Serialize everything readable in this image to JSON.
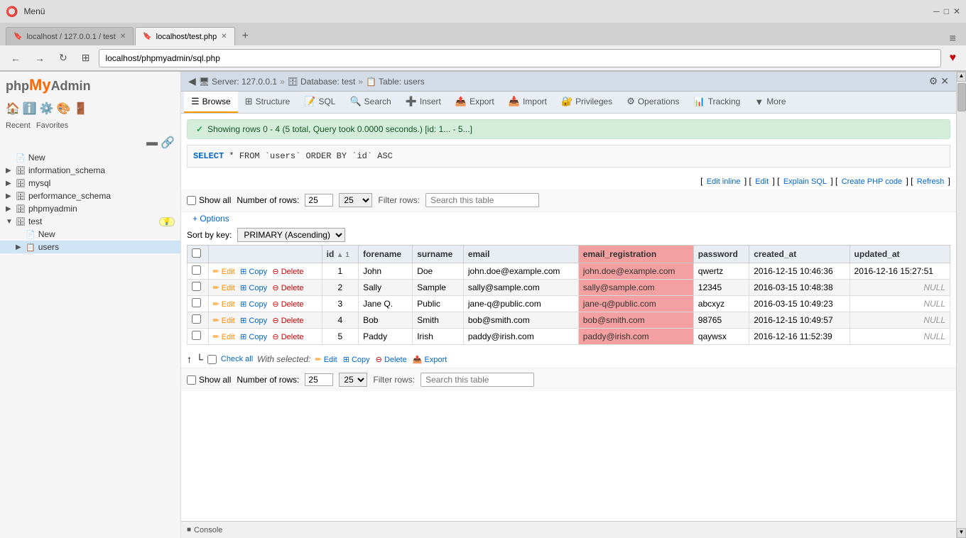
{
  "browser": {
    "title": "Menü",
    "tabs": [
      {
        "id": "tab1",
        "favicon": "🔖",
        "label": "localhost / 127.0.0.1 / test",
        "active": false,
        "closeable": true
      },
      {
        "id": "tab2",
        "favicon": "🔖",
        "label": "localhost/test.php",
        "active": true,
        "closeable": true
      }
    ],
    "new_tab_label": "+",
    "nav": {
      "back": "←",
      "forward": "→",
      "reload": "↻",
      "apps": "⊞",
      "url": "localhost/phpmyadmin/sql.php",
      "heart": "♥"
    }
  },
  "breadcrumb": {
    "parts": [
      {
        "icon": "🖥",
        "label": "Server: 127.0.0.1"
      },
      {
        "icon": "🗄",
        "label": "Database: test"
      },
      {
        "icon": "📋",
        "label": "Table: users"
      }
    ],
    "icons": [
      "⚙",
      "✕"
    ]
  },
  "toolbar": {
    "tabs": [
      {
        "icon": "☰",
        "label": "Browse",
        "active": true
      },
      {
        "icon": "📐",
        "label": "Structure",
        "active": false
      },
      {
        "icon": "📝",
        "label": "SQL",
        "active": false
      },
      {
        "icon": "🔍",
        "label": "Search",
        "active": false
      },
      {
        "icon": "➕",
        "label": "Insert",
        "active": false
      },
      {
        "icon": "📤",
        "label": "Export",
        "active": false
      },
      {
        "icon": "📥",
        "label": "Import",
        "active": false
      },
      {
        "icon": "🔐",
        "label": "Privileges",
        "active": false
      },
      {
        "icon": "⚙",
        "label": "Operations",
        "active": false
      },
      {
        "icon": "📊",
        "label": "Tracking",
        "active": false
      },
      {
        "icon": "▼",
        "label": "More",
        "active": false
      }
    ]
  },
  "alert": {
    "icon": "✓",
    "text": "Showing rows 0 - 4 (5 total, Query took 0.0000 seconds.) [id: 1... - 5...]"
  },
  "sql": {
    "text": "SELECT * FROM `users` ORDER BY `id` ASC",
    "keyword": "SELECT",
    "links": [
      {
        "label": "Edit inline"
      },
      {
        "label": "Edit"
      },
      {
        "label": "Explain SQL"
      },
      {
        "label": "Create PHP code"
      },
      {
        "label": "Refresh"
      }
    ]
  },
  "table_controls": {
    "show_all_label": "Show all",
    "num_rows_label": "Number of rows:",
    "num_rows_value": "25",
    "filter_label": "Filter rows:",
    "filter_placeholder": "Search this table"
  },
  "sort_controls": {
    "label": "Sort by key:",
    "value": "PRIMARY (Ascending)"
  },
  "options_label": "+ Options",
  "columns": [
    {
      "name": "",
      "type": "checkbox"
    },
    {
      "name": "",
      "type": "actions"
    },
    {
      "name": "id",
      "sort": "▲ 1"
    },
    {
      "name": "forename"
    },
    {
      "name": "surname"
    },
    {
      "name": "email"
    },
    {
      "name": "email_registration",
      "highlighted": true
    },
    {
      "name": "password"
    },
    {
      "name": "created_at"
    },
    {
      "name": "updated_at"
    }
  ],
  "rows": [
    {
      "id": "1",
      "forename": "John",
      "surname": "Doe",
      "email": "john.doe@example.com",
      "email_registration": "john.doe@example.com",
      "password": "qwertz",
      "created_at": "2016-12-15 10:46:36",
      "updated_at": "2016-12-16 15:27:51"
    },
    {
      "id": "2",
      "forename": "Sally",
      "surname": "Sample",
      "email": "sally@sample.com",
      "email_registration": "sally@sample.com",
      "password": "12345",
      "created_at": "2016-03-15 10:48:38",
      "updated_at": "NULL"
    },
    {
      "id": "3",
      "forename": "Jane Q.",
      "surname": "Public",
      "email": "jane-q@public.com",
      "email_registration": "jane-q@public.com",
      "password": "abcxyz",
      "created_at": "2016-03-15 10:49:23",
      "updated_at": "NULL"
    },
    {
      "id": "4",
      "forename": "Bob",
      "surname": "Smith",
      "email": "bob@smith.com",
      "email_registration": "bob@smith.com",
      "password": "98765",
      "created_at": "2016-12-15 10:49:57",
      "updated_at": "NULL"
    },
    {
      "id": "5",
      "forename": "Paddy",
      "surname": "Irish",
      "email": "paddy@irish.com",
      "email_registration": "paddy@irish.com",
      "password": "qaywsx",
      "created_at": "2016-12-16 11:52:39",
      "updated_at": "NULL"
    }
  ],
  "actions": {
    "edit": "Edit",
    "copy": "Copy",
    "delete": "Delete",
    "export": "Export"
  },
  "bottom": {
    "check_all": "Check all",
    "with_selected": "With selected:",
    "edit": "Edit",
    "copy": "Copy",
    "delete": "Delete",
    "export": "Export"
  },
  "console": {
    "label": "Console"
  },
  "sidebar": {
    "logo_php": "php",
    "logo_my": "My",
    "logo_admin": "Admin",
    "tabs": [
      "Recent",
      "Favorites"
    ],
    "new_label": "New",
    "items": [
      {
        "label": "New",
        "level": 0,
        "icon": "📄",
        "expanded": false
      },
      {
        "label": "information_schema",
        "level": 0,
        "icon": "🗄",
        "expanded": false
      },
      {
        "label": "mysql",
        "level": 0,
        "icon": "🗄",
        "expanded": false
      },
      {
        "label": "performance_schema",
        "level": 0,
        "icon": "🗄",
        "expanded": false
      },
      {
        "label": "phpmyadmin",
        "level": 0,
        "icon": "🗄",
        "expanded": false
      },
      {
        "label": "test",
        "level": 0,
        "icon": "🗄",
        "expanded": true,
        "badge": "💡"
      },
      {
        "label": "New",
        "level": 1,
        "icon": "📄"
      },
      {
        "label": "users",
        "level": 1,
        "icon": "📋",
        "selected": true
      }
    ]
  }
}
